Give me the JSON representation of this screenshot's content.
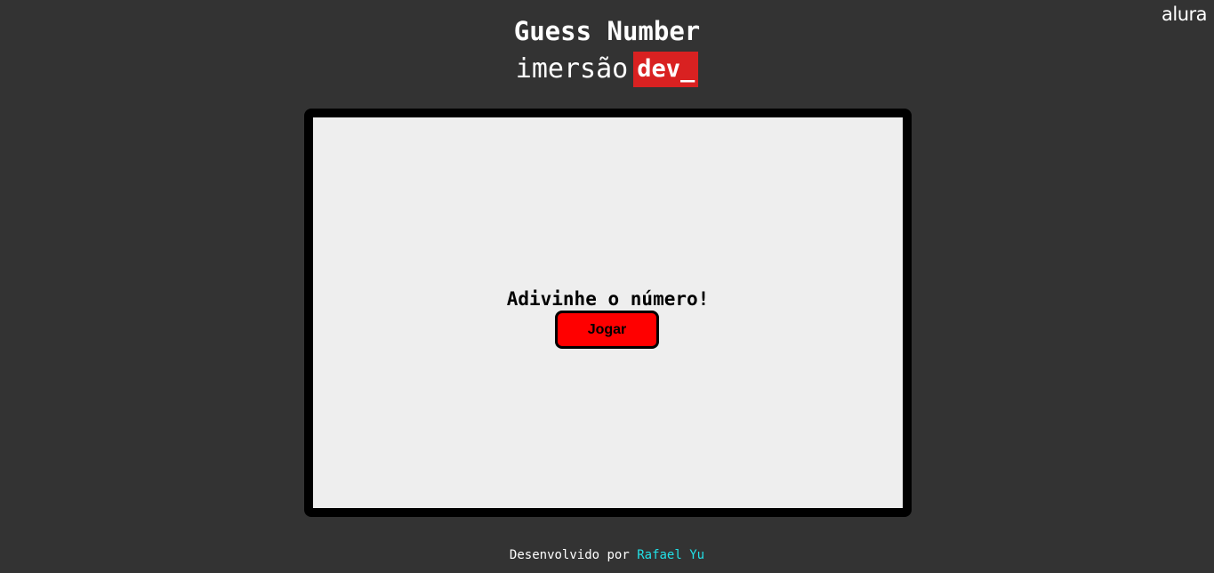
{
  "brand": {
    "logo_text": "alura"
  },
  "header": {
    "title": "Guess Number",
    "subtitle_text": "imersão",
    "subtitle_badge": "dev_"
  },
  "game": {
    "heading": "Adivinhe o número!",
    "play_button_label": "Jogar"
  },
  "footer": {
    "prefix": "Desenvolvido por",
    "author": "Rafael Yu"
  },
  "colors": {
    "background": "#333333",
    "badge": "#d92121",
    "button": "#ff0000",
    "screen": "#eeeeee",
    "author_link": "#22e0e6"
  }
}
